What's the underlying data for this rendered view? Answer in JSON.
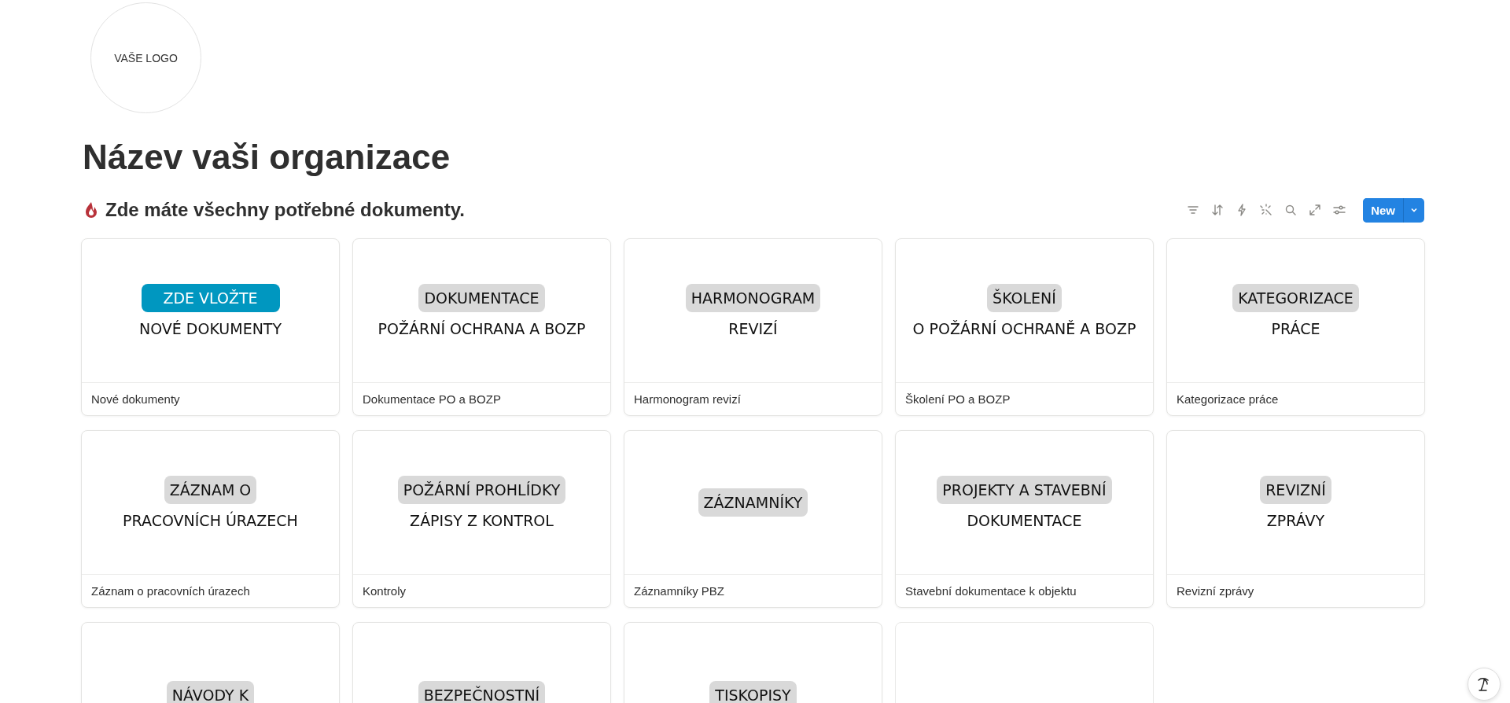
{
  "logo": {
    "text": "VAŠE LOGO"
  },
  "title": "Název vaši organizace",
  "view": {
    "title": "Zde máte všechny potřebné dokumenty.",
    "new_button": "New"
  },
  "cards": [
    {
      "kind": "cover",
      "badge": "ZDE VLOŽTE",
      "highlighted": true,
      "line2": "NOVÉ DOKUMENTY",
      "caption": "Nové dokumenty"
    },
    {
      "kind": "cover",
      "badge": "DOKUMENTACE",
      "highlighted": false,
      "line2": "POŽÁRNÍ OCHRANA A BOZP",
      "caption": "Dokumentace PO a BOZP"
    },
    {
      "kind": "cover",
      "badge": "HARMONOGRAM",
      "highlighted": false,
      "line2": "REVIZÍ",
      "caption": "Harmonogram revizí"
    },
    {
      "kind": "cover",
      "badge": "ŠKOLENÍ",
      "highlighted": false,
      "line2": "O POŽÁRNÍ OCHRANĚ A BOZP",
      "caption": "Školení PO a BOZP"
    },
    {
      "kind": "cover",
      "badge": "KATEGORIZACE",
      "highlighted": false,
      "line2": "PRÁCE",
      "caption": "Kategorizace práce"
    },
    {
      "kind": "cover",
      "badge": "ZÁZNAM O",
      "highlighted": false,
      "line2": "PRACOVNÍCH ÚRAZECH",
      "caption": "Záznam o pracovních úrazech"
    },
    {
      "kind": "cover",
      "badge": "POŽÁRNÍ PROHLÍDKY",
      "highlighted": false,
      "line2": "ZÁPISY Z KONTROL",
      "caption": "Kontroly"
    },
    {
      "kind": "cover",
      "badge": "ZÁZNAMNÍKY",
      "highlighted": false,
      "caption": "Záznamníky PBZ"
    },
    {
      "kind": "cover",
      "badge": "PROJEKTY A STAVEBNÍ",
      "highlighted": false,
      "line2": "DOKUMENTACE",
      "caption": "Stavební dokumentace k objektu"
    },
    {
      "kind": "cover",
      "badge": "REVIZNÍ",
      "highlighted": false,
      "line2": "ZPRÁVY",
      "caption": "Revizní zprávy"
    },
    {
      "kind": "cover",
      "badge": "NÁVODY K",
      "highlighted": false
    },
    {
      "kind": "cover",
      "badge": "BEZPEČNOSTNÍ",
      "highlighted": false
    },
    {
      "kind": "cover",
      "badge": "TISKOPISY",
      "highlighted": false
    },
    {
      "kind": "blank"
    }
  ]
}
